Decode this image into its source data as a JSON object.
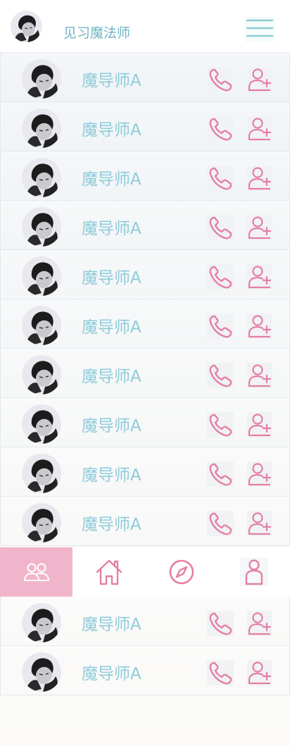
{
  "header": {
    "title": "见习魔法师",
    "avatar_icon": "user-portrait-icon",
    "menu_icon": "hamburger-menu-icon"
  },
  "colors": {
    "accent_teal": "#6fb4c4",
    "name_teal": "#8fcbd9",
    "pink": "#e57fa4",
    "tab_active_bg": "#f1b5cb"
  },
  "contacts": [
    {
      "name": "魔导师A"
    },
    {
      "name": "魔导师A"
    },
    {
      "name": "魔导师A"
    },
    {
      "name": "魔导师A"
    },
    {
      "name": "魔导师A"
    },
    {
      "name": "魔导师A"
    },
    {
      "name": "魔导师A"
    },
    {
      "name": "魔导师A"
    },
    {
      "name": "魔导师A"
    },
    {
      "name": "魔导师A"
    }
  ],
  "contacts_below": [
    {
      "name": "魔导师A"
    },
    {
      "name": "魔导师A"
    }
  ],
  "row_icons": {
    "call": "phone-icon",
    "add": "add-friend-icon"
  },
  "tabs": [
    {
      "icon": "friends-icon",
      "active": true
    },
    {
      "icon": "home-icon",
      "active": false
    },
    {
      "icon": "compass-icon",
      "active": false
    },
    {
      "icon": "profile-icon",
      "active": false
    }
  ]
}
